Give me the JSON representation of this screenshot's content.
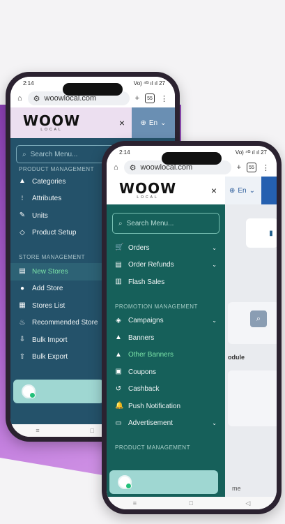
{
  "back_phone": {
    "status_time": "2:14",
    "status_right": "Vo) ⁴ᴳ ıl ıl 27",
    "url": "woowlocal.com",
    "tab_count": "55",
    "lang": "En",
    "search_placeholder": "Search Menu...",
    "cut_section": "PRODUCT MANAGEMENT",
    "items_top": [
      {
        "icon": "▲",
        "label": "Categories"
      },
      {
        "icon": "⁝",
        "label": "Attributes"
      },
      {
        "icon": "✎",
        "label": "Units"
      },
      {
        "icon": "◇",
        "label": "Product Setup"
      }
    ],
    "section": "STORE MANAGEMENT",
    "items_store": [
      {
        "icon": "▤",
        "label": "New Stores"
      },
      {
        "icon": "●",
        "label": "Add Store"
      },
      {
        "icon": "▦",
        "label": "Stores List"
      },
      {
        "icon": "♨",
        "label": "Recommended Store"
      },
      {
        "icon": "⇩",
        "label": "Bulk Import"
      },
      {
        "icon": "⇧",
        "label": "Bulk Export"
      }
    ]
  },
  "front_phone": {
    "status_time": "2:14",
    "status_right": "Vo) ⁴ᴳ ıl ıl 27",
    "url": "woowlocal.com",
    "tab_count": "55",
    "lang": "En",
    "logo": "WOOW",
    "logo_sub": "LOCAL",
    "search_placeholder": "Search Menu...",
    "items_orders": [
      {
        "icon": "🛒",
        "label": "Orders",
        "chevron": true
      },
      {
        "icon": "▤",
        "label": "Order Refunds",
        "chevron": true
      },
      {
        "icon": "▥",
        "label": "Flash Sales",
        "chevron": false
      }
    ],
    "section_promo": "PROMOTION MANAGEMENT",
    "items_promo": [
      {
        "icon": "◈",
        "label": "Campaigns",
        "chevron": true
      },
      {
        "icon": "▲",
        "label": "Banners",
        "chevron": false
      },
      {
        "icon": "▲",
        "label": "Other Banners",
        "chevron": false
      },
      {
        "icon": "▣",
        "label": "Coupons",
        "chevron": false
      },
      {
        "icon": "↺",
        "label": "Cashback",
        "chevron": false
      },
      {
        "icon": "🔔",
        "label": "Push Notification",
        "chevron": false
      },
      {
        "icon": "▭",
        "label": "Advertisement",
        "chevron": true
      }
    ],
    "section_product": "PRODUCT MANAGEMENT",
    "side_text_module": "odule",
    "side_text_home": "me"
  },
  "back_logo": "WOOW",
  "back_logo_sub": "LOCAL"
}
